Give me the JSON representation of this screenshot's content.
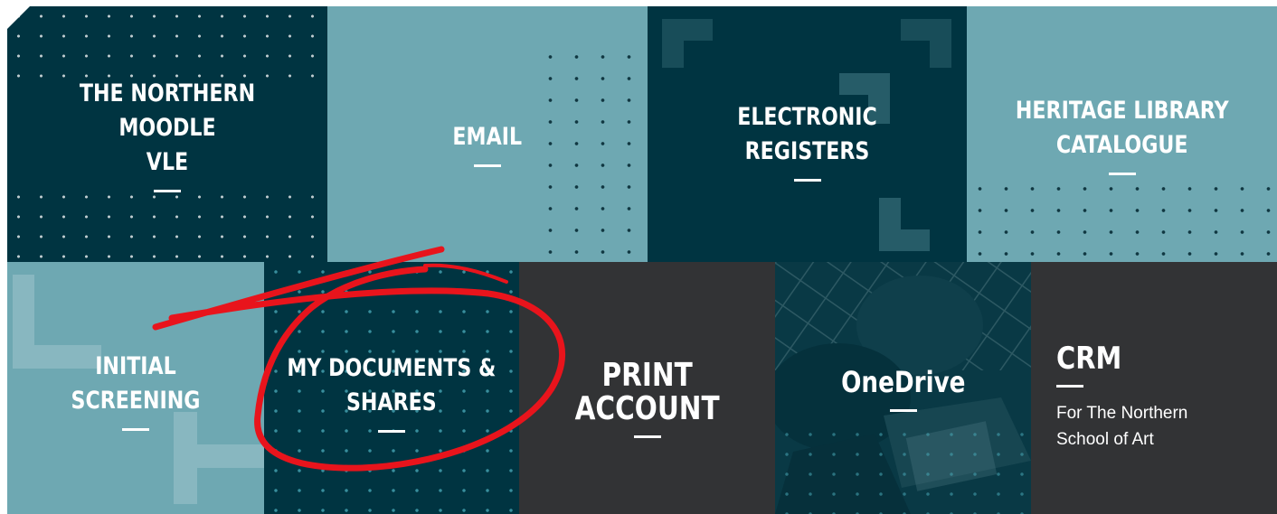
{
  "tiles": {
    "moodle": {
      "title": "THE NORTHERN MOODLE\nVLE"
    },
    "email": {
      "title": "EMAIL"
    },
    "registers": {
      "title": "ELECTRONIC REGISTERS"
    },
    "heritage": {
      "title": "HERITAGE LIBRARY\nCATALOGUE"
    },
    "screening": {
      "title": "INITIAL SCREENING"
    },
    "documents": {
      "title": "MY DOCUMENTS &\nSHARES"
    },
    "print": {
      "title": "PRINT\nACCOUNT"
    },
    "onedrive": {
      "title": "OneDrive"
    },
    "crm": {
      "title": "CRM",
      "subtitle": "For The Northern School of Art"
    }
  },
  "colors": {
    "dark_teal": "#003441",
    "light_teal": "#6ea8b2",
    "charcoal": "#323335",
    "annotation_red": "#e8141c"
  },
  "icons": {
    "annotation": "red-circle-annotation",
    "onedrive_bg": "photo-background"
  }
}
